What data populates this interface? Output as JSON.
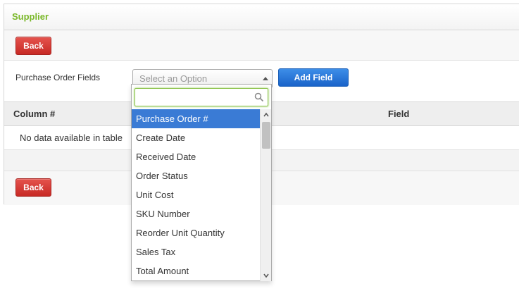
{
  "panel": {
    "title": "Supplier"
  },
  "toolbar": {
    "back_label": "Back"
  },
  "form": {
    "field_label": "Purchase Order Fields",
    "select_placeholder": "Select an Option",
    "add_field_label": "Add Field"
  },
  "table": {
    "headers": [
      "Column #",
      "Field"
    ],
    "empty_text": "No data available in table"
  },
  "footer": {
    "back_label": "Back"
  },
  "dropdown": {
    "search_value": "",
    "options": [
      "Purchase Order #",
      "Create Date",
      "Received Date",
      "Order Status",
      "Unit Cost",
      "SKU Number",
      "Reorder Unit Quantity",
      "Sales Tax",
      "Total Amount"
    ],
    "selected_index": 0
  },
  "colors": {
    "title_green": "#7ab829",
    "back_red": "#d9342e",
    "add_blue": "#2e7ddb",
    "selected_blue": "#3a7bd5"
  },
  "icons": [
    "search-icon",
    "chevron-up-icon",
    "chevron-down-icon",
    "select-arrow-icon"
  ]
}
